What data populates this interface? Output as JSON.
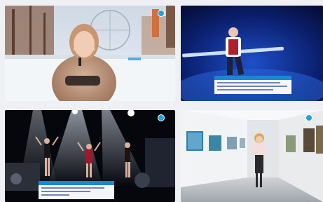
{
  "tiles": [
    {
      "name": "winter-reporter",
      "caption": "",
      "caption_strip": ""
    },
    {
      "name": "circus-performer",
      "caption": "",
      "caption_strip": ""
    },
    {
      "name": "stage-dancers",
      "caption": "",
      "caption_strip": ""
    },
    {
      "name": "art-gallery",
      "caption": "",
      "caption_strip": ""
    }
  ],
  "colors": {
    "channel_icon": "#1fa3e0",
    "caption_bg": "#f4f6f8",
    "caption_strip": "#1b86d1"
  },
  "icons": {
    "channel": "channel-logo-icon",
    "card": "card-icon"
  }
}
